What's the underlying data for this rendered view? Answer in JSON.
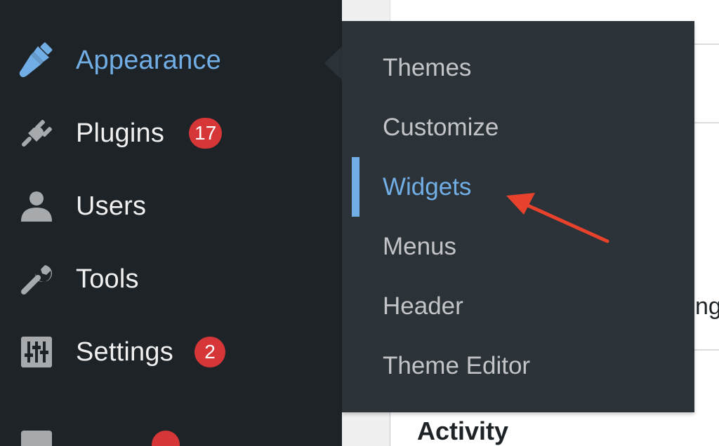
{
  "sidebar": {
    "items": [
      {
        "label": "Appearance",
        "icon": "paintbrush-icon",
        "current": true,
        "badge": ""
      },
      {
        "label": "Plugins",
        "icon": "plugin-icon",
        "current": false,
        "badge": "17"
      },
      {
        "label": "Users",
        "icon": "user-icon",
        "current": false,
        "badge": ""
      },
      {
        "label": "Tools",
        "icon": "wrench-icon",
        "current": false,
        "badge": ""
      },
      {
        "label": "Settings",
        "icon": "settings-sliders-icon",
        "current": false,
        "badge": "2"
      }
    ]
  },
  "submenu": {
    "items": [
      {
        "label": "Themes",
        "current": false
      },
      {
        "label": "Customize",
        "current": false
      },
      {
        "label": "Widgets",
        "current": true
      },
      {
        "label": "Menus",
        "current": false
      },
      {
        "label": "Header",
        "current": false
      },
      {
        "label": "Theme Editor",
        "current": false
      }
    ]
  },
  "background": {
    "activity_heading": "Activity",
    "clipped_text": "ng"
  },
  "colors": {
    "sidebar_bg": "#1d2327",
    "submenu_bg": "#2c3338",
    "accent_blue": "#72aee6",
    "badge_red": "#d63638",
    "arrow_red": "#e8412c"
  }
}
